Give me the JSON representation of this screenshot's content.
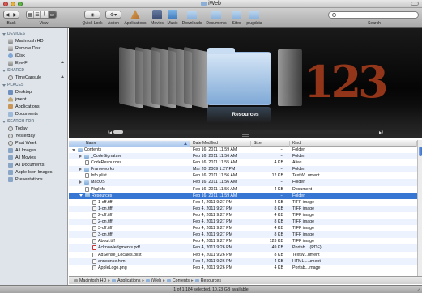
{
  "window": {
    "title": "iWeb"
  },
  "toolbar": {
    "back_label": "Back",
    "view_label": "View",
    "quicklook_label": "Quick Look",
    "action_label": "Action",
    "search_label": "Search",
    "favorites": [
      {
        "label": "Applications",
        "icon": "applications-icon"
      },
      {
        "label": "Movies",
        "icon": "movies-icon"
      },
      {
        "label": "Music",
        "icon": "music-icon"
      },
      {
        "label": "Downloads",
        "icon": "downloads-folder-icon"
      },
      {
        "label": "Documents",
        "icon": "documents-folder-icon"
      },
      {
        "label": "Sites",
        "icon": "sites-folder-icon"
      },
      {
        "label": "plugdata",
        "icon": "plugdata-folder-icon"
      }
    ]
  },
  "sidebar": {
    "sections": [
      {
        "title": "DEVICES",
        "items": [
          "Macintosh HD",
          "Remote Disc",
          "iDisk",
          "Eye-Fi"
        ]
      },
      {
        "title": "SHARED",
        "items": [
          "TimeCapsule"
        ]
      },
      {
        "title": "PLACES",
        "items": [
          "Desktop",
          "jment",
          "Applications",
          "Documents"
        ]
      },
      {
        "title": "SEARCH FOR",
        "items": [
          "Today",
          "Yesterday",
          "Past Week",
          "All Images",
          "All Movies",
          "All Documents",
          "Apple Icon Images",
          "Presentations"
        ]
      }
    ]
  },
  "coverflow": {
    "selected_label": "Resources",
    "right_preview_text": "123"
  },
  "list": {
    "columns": {
      "name": "Name",
      "date": "Date Modified",
      "size": "Size",
      "kind": "Kind"
    },
    "rows": [
      {
        "name": "Contents",
        "date": "Feb 16, 2011 11:59 AM",
        "size": "--",
        "kind": "Folder",
        "level": 0,
        "disc": "open",
        "icon": "folder"
      },
      {
        "name": "_CodeSignature",
        "date": "Feb 16, 2011 11:56 AM",
        "size": "--",
        "kind": "Folder",
        "level": 1,
        "disc": "closed",
        "icon": "folder"
      },
      {
        "name": "CodeResources",
        "date": "Feb 16, 2011 11:55 AM",
        "size": "4 KB",
        "kind": "Alias",
        "level": 1,
        "disc": "none",
        "icon": "doc"
      },
      {
        "name": "Frameworks",
        "date": "Mar 20, 2009 1:27 PM",
        "size": "--",
        "kind": "Folder",
        "level": 1,
        "disc": "closed",
        "icon": "folder"
      },
      {
        "name": "Info.plist",
        "date": "Feb 16, 2011 11:56 AM",
        "size": "12 KB",
        "kind": "TextW...ument",
        "level": 1,
        "disc": "none",
        "icon": "doc"
      },
      {
        "name": "MacOS",
        "date": "Feb 16, 2011 11:56 AM",
        "size": "--",
        "kind": "Folder",
        "level": 1,
        "disc": "closed",
        "icon": "folder"
      },
      {
        "name": "PkgInfo",
        "date": "Feb 16, 2011 11:56 AM",
        "size": "4 KB",
        "kind": "Document",
        "level": 1,
        "disc": "none",
        "icon": "doc"
      },
      {
        "name": "Resources",
        "date": "Feb 16, 2011 11:59 AM",
        "size": "--",
        "kind": "Folder",
        "level": 1,
        "disc": "open",
        "icon": "folder",
        "selected": true
      },
      {
        "name": "1-off.tiff",
        "date": "Feb 4, 2011 9:27 PM",
        "size": "4 KB",
        "kind": "TIFF image",
        "level": 2,
        "disc": "none",
        "icon": "img"
      },
      {
        "name": "1-on.tiff",
        "date": "Feb 4, 2011 9:27 PM",
        "size": "8 KB",
        "kind": "TIFF image",
        "level": 2,
        "disc": "none",
        "icon": "img"
      },
      {
        "name": "2-off.tiff",
        "date": "Feb 4, 2011 9:27 PM",
        "size": "4 KB",
        "kind": "TIFF image",
        "level": 2,
        "disc": "none",
        "icon": "img"
      },
      {
        "name": "2-on.tiff",
        "date": "Feb 4, 2011 9:27 PM",
        "size": "8 KB",
        "kind": "TIFF image",
        "level": 2,
        "disc": "none",
        "icon": "img"
      },
      {
        "name": "3-off.tiff",
        "date": "Feb 4, 2011 9:27 PM",
        "size": "4 KB",
        "kind": "TIFF image",
        "level": 2,
        "disc": "none",
        "icon": "img"
      },
      {
        "name": "3-on.tiff",
        "date": "Feb 4, 2011 9:27 PM",
        "size": "8 KB",
        "kind": "TIFF image",
        "level": 2,
        "disc": "none",
        "icon": "img"
      },
      {
        "name": "About.tiff",
        "date": "Feb 4, 2011 9:27 PM",
        "size": "123 KB",
        "kind": "TIFF image",
        "level": 2,
        "disc": "none",
        "icon": "img"
      },
      {
        "name": "Acknowledgments.pdf",
        "date": "Feb 4, 2011 9:26 PM",
        "size": "49 KB",
        "kind": "Portab... (PDF)",
        "level": 2,
        "disc": "none",
        "icon": "img-red"
      },
      {
        "name": "AdSense_Locales.plist",
        "date": "Feb 4, 2011 9:26 PM",
        "size": "8 KB",
        "kind": "TextW...ument",
        "level": 2,
        "disc": "none",
        "icon": "doc"
      },
      {
        "name": "announce.html",
        "date": "Feb 4, 2011 9:26 PM",
        "size": "4 KB",
        "kind": "HTML ...ument",
        "level": 2,
        "disc": "none",
        "icon": "doc"
      },
      {
        "name": "AppleLogo.png",
        "date": "Feb 4, 2011 9:26 PM",
        "size": "4 KB",
        "kind": "Portab...image",
        "level": 2,
        "disc": "none",
        "icon": "img"
      }
    ]
  },
  "pathbar": [
    "Macintosh HD",
    "Applications",
    "iWeb",
    "Contents",
    "Resources"
  ],
  "status": {
    "text": "1 of 1,184 selected, 10.23 GB available"
  }
}
